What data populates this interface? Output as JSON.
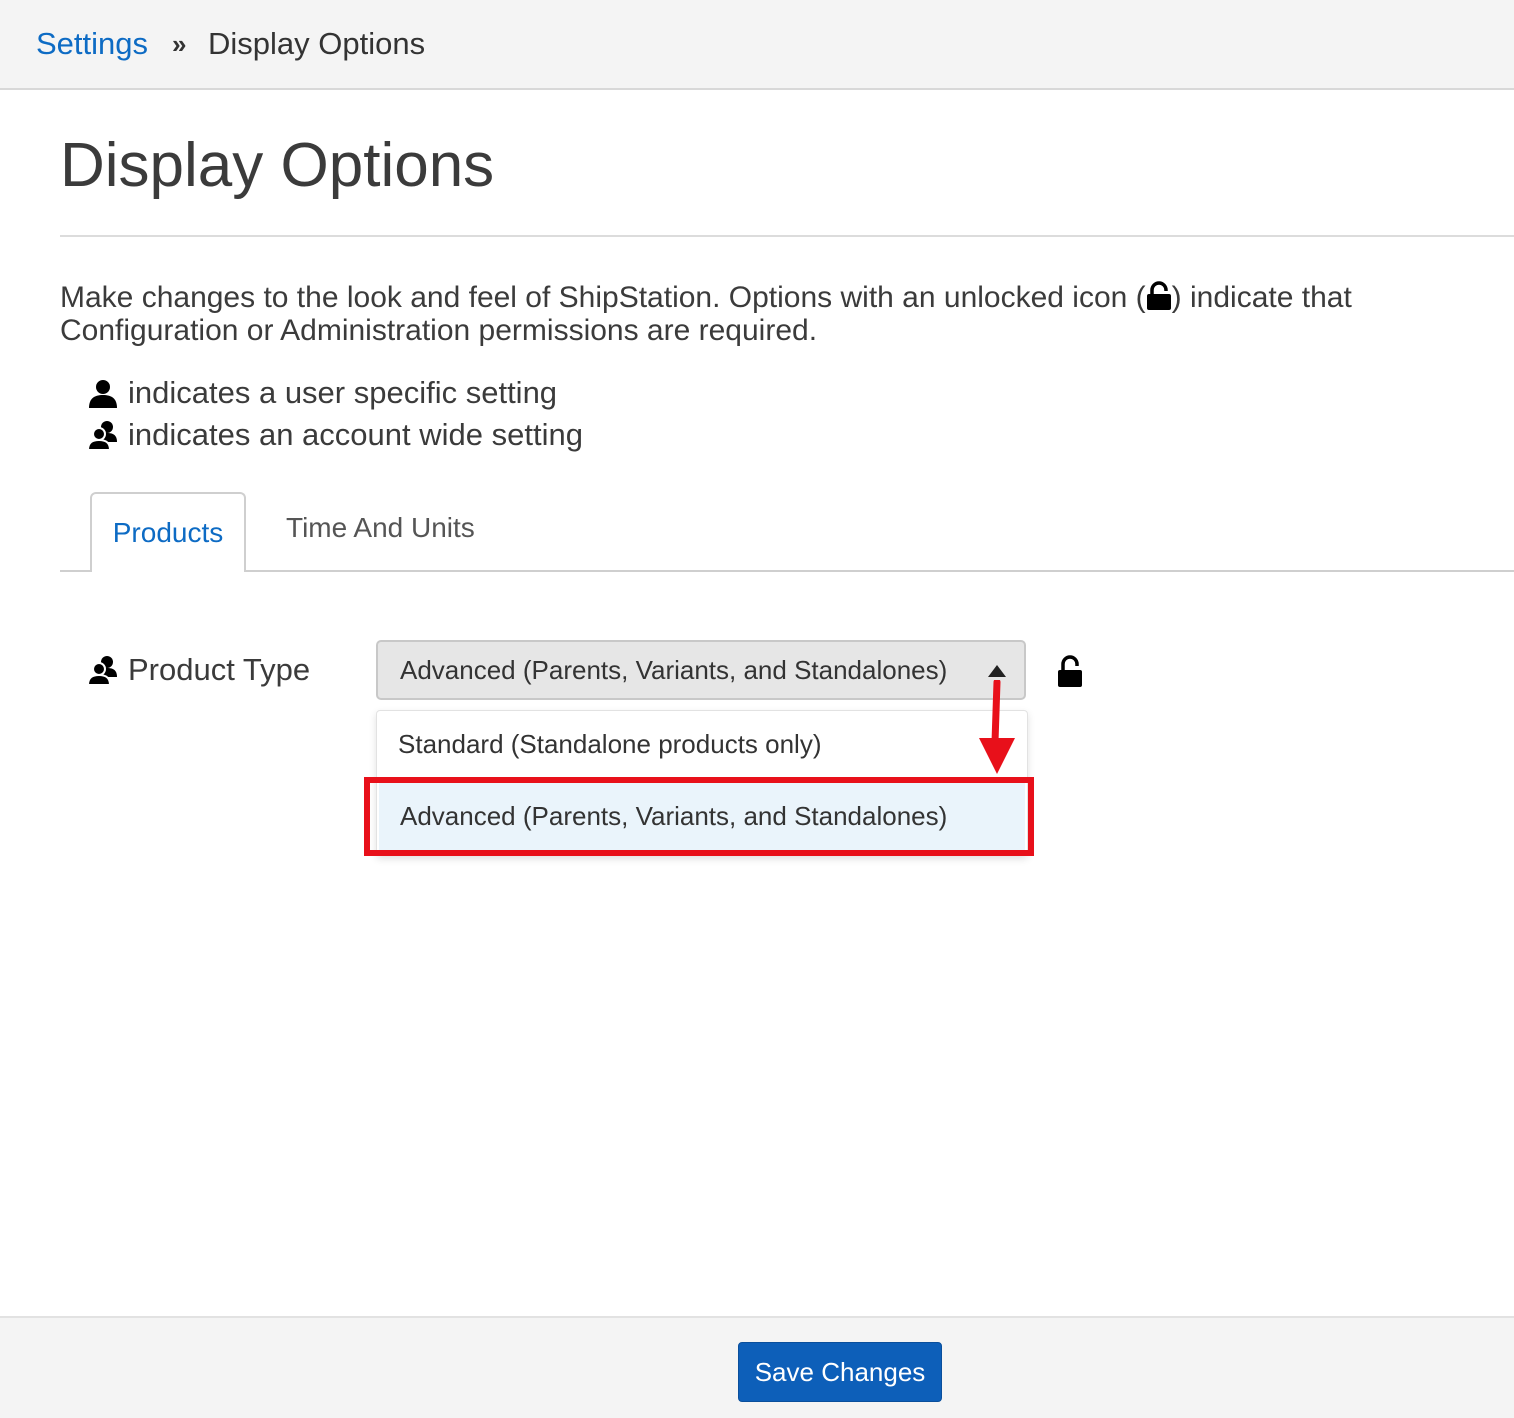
{
  "breadcrumb": {
    "parent": "Settings",
    "separator": "»",
    "current": "Display Options"
  },
  "page": {
    "title": "Display Options",
    "description_part1": "Make changes to the look and feel of ShipStation. Options with an unlocked icon (",
    "description_part2": ") indicate that Configuration or Administration permissions are required.",
    "legend_user": "indicates a user specific setting",
    "legend_account": "indicates an account wide setting"
  },
  "tabs": [
    {
      "label": "Products",
      "active": true
    },
    {
      "label": "Time And Units",
      "active": false
    }
  ],
  "product_type": {
    "label": "Product Type",
    "selected": "Advanced (Parents, Variants, and Standalones)",
    "options": [
      "Standard (Standalone products only)",
      "Advanced (Parents, Variants, and Standalones)"
    ],
    "expanded": true
  },
  "footer": {
    "save_label": "Save Changes"
  },
  "colors": {
    "link": "#0d6bc4",
    "button": "#0d5fb9",
    "highlight": "#e8101a",
    "option_hover": "#eaf4fb"
  },
  "icons": [
    "unlock-icon",
    "user-icon",
    "users-icon",
    "caret-up-icon"
  ]
}
